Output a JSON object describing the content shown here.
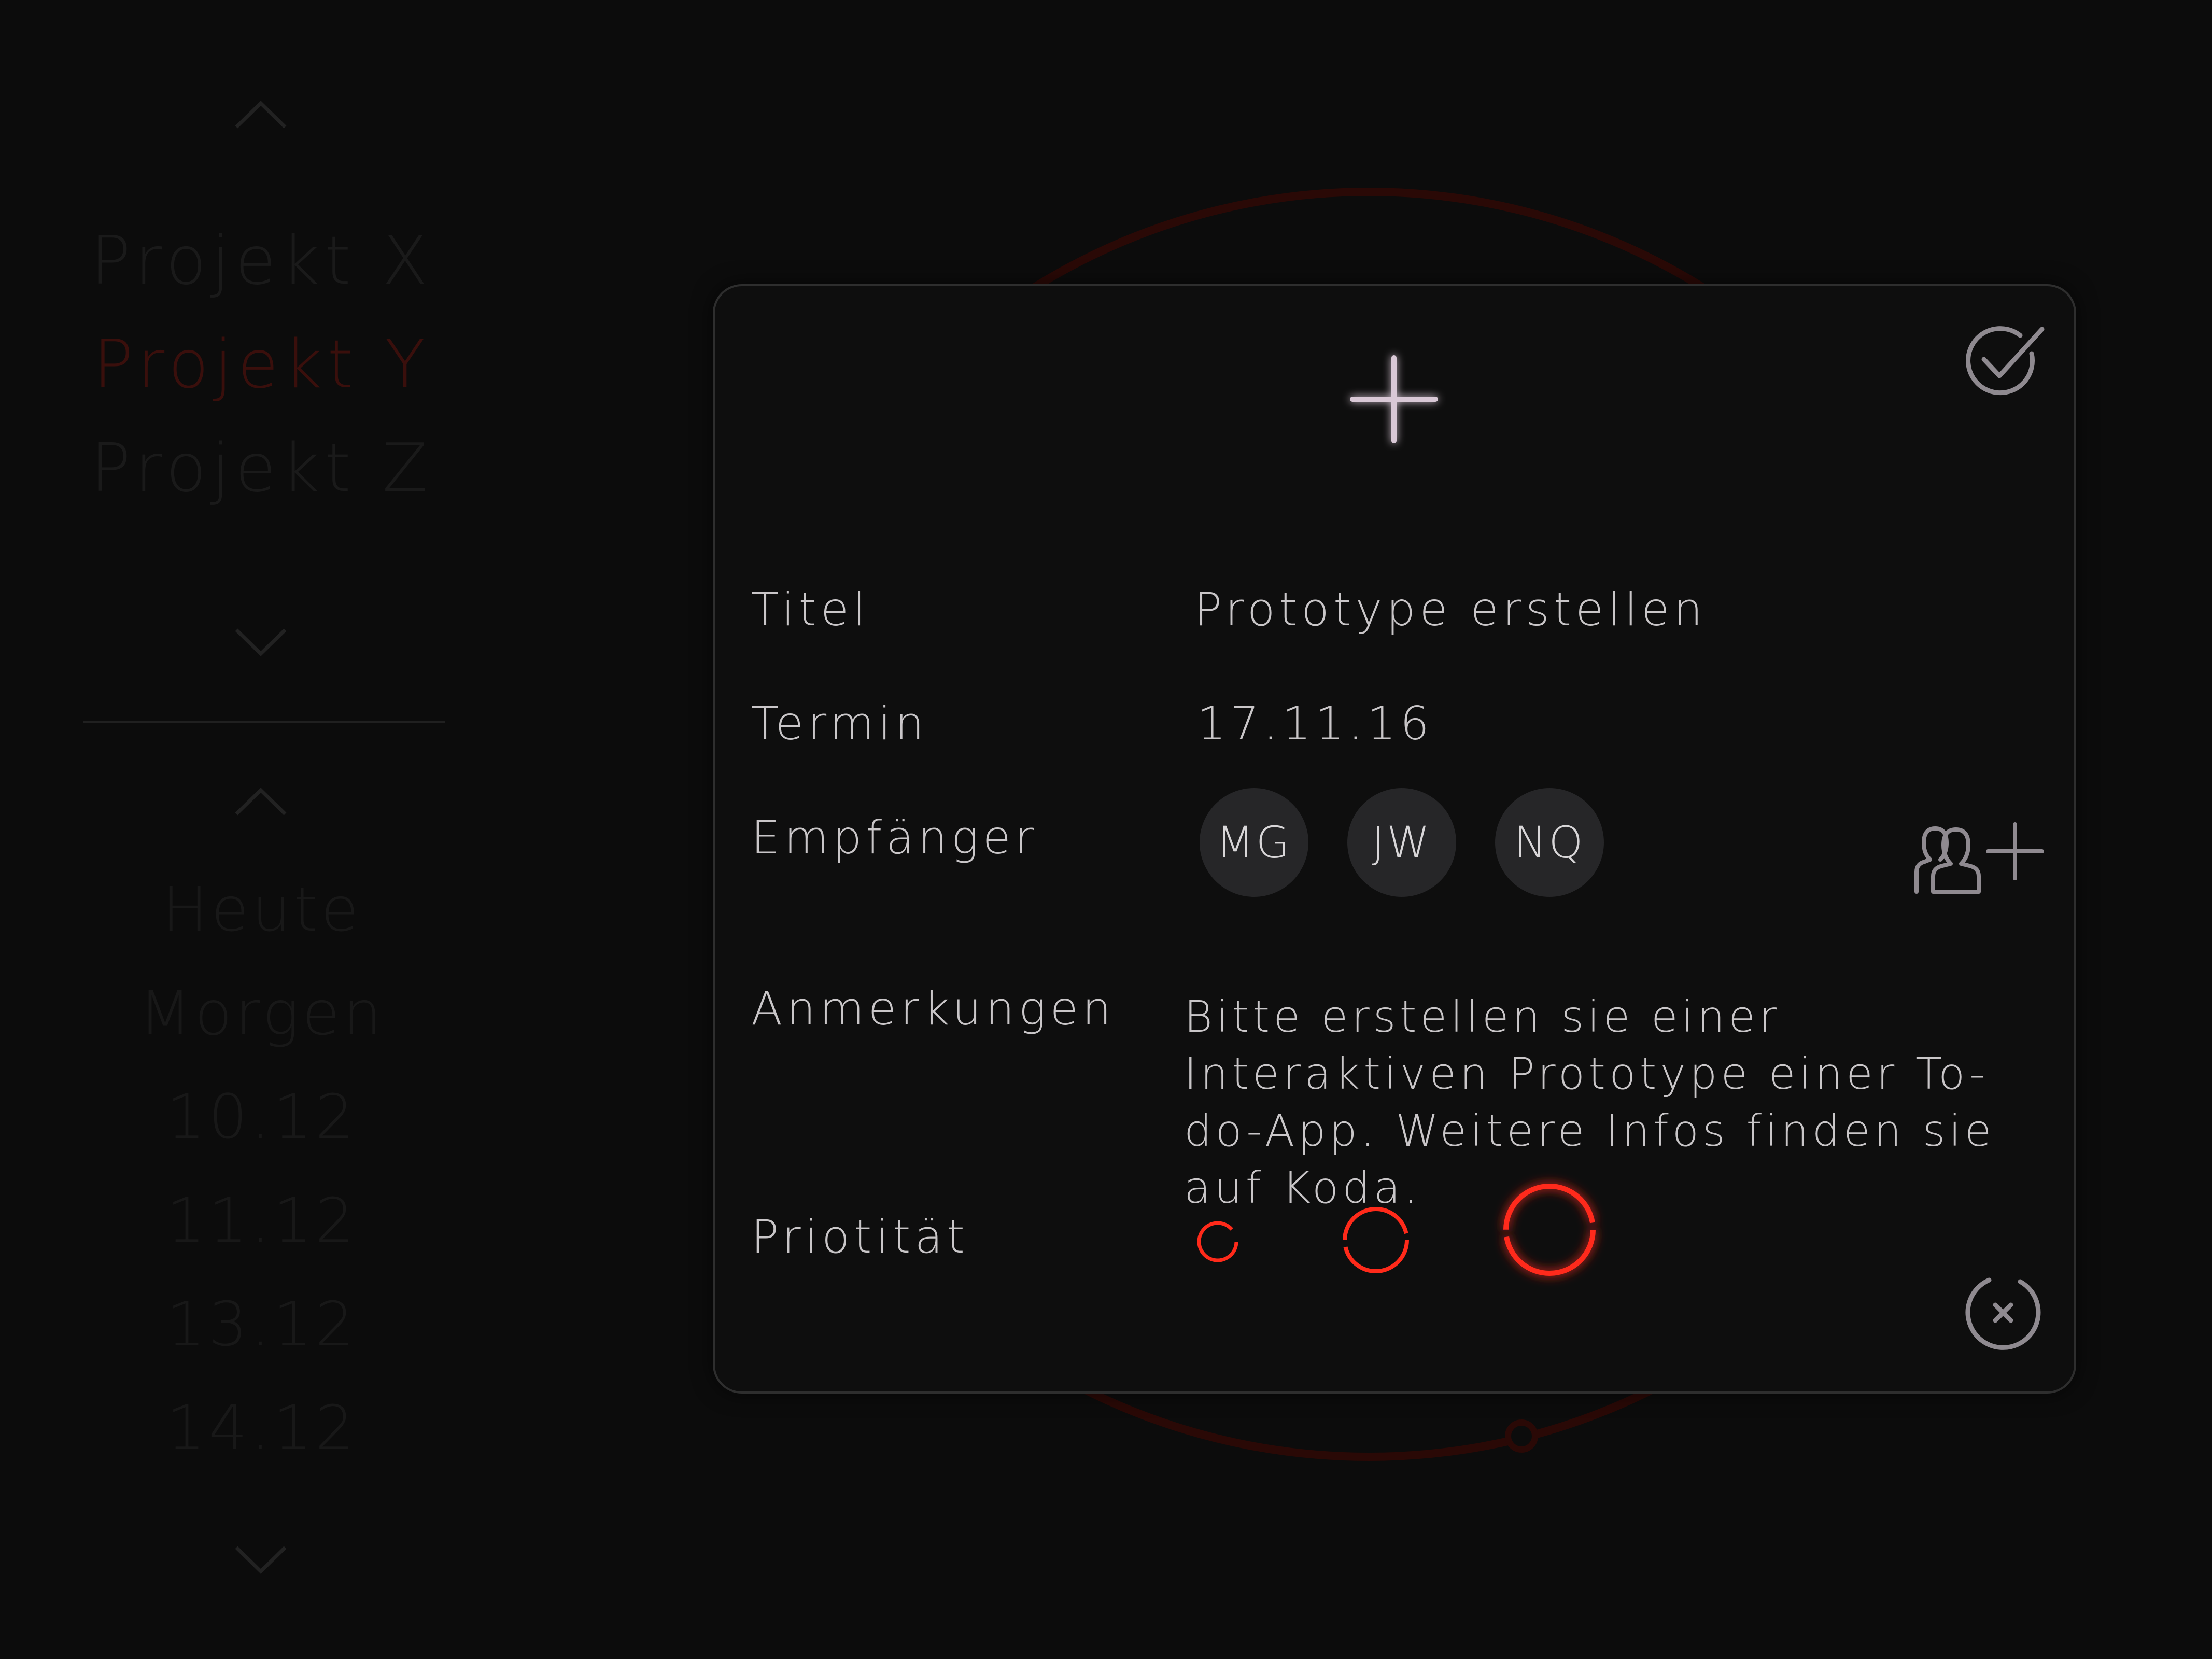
{
  "sidebar": {
    "projects": [
      {
        "label": "Projekt X",
        "active": false
      },
      {
        "label": "Projekt Y",
        "active": true
      },
      {
        "label": "Projekt Z",
        "active": false
      }
    ],
    "dates": [
      "Heute",
      "Morgen",
      "10.12",
      "11.12",
      "13.12",
      "14.12"
    ]
  },
  "dialog": {
    "fields": {
      "title_label": "Titel",
      "title_value": "Prototype erstellen",
      "date_label": "Termin",
      "date_value": "17.11.16",
      "recipients_label": "Empfänger",
      "recipients": [
        "MG",
        "JW",
        "NQ"
      ],
      "notes_label": "Anmerkungen",
      "notes_value": "Bitte erstellen sie einer Interaktiven Prototype einer To-do-App. Weitere Infos finden sie auf Koda.",
      "priority_label": "Priotität"
    },
    "priority_levels": [
      "low",
      "medium",
      "high"
    ],
    "priority_selected": "high",
    "icons": {
      "add": "plus-icon",
      "confirm": "check-circle-icon",
      "cancel": "close-circle-icon",
      "add_recipient": "add-user-icon"
    }
  },
  "colors": {
    "background": "#0c0c0c",
    "accent_red": "#ff2a1a",
    "text": "#c9c6c8",
    "dim_text": "#1a1a1a",
    "active_project": "#3a0f0c"
  }
}
